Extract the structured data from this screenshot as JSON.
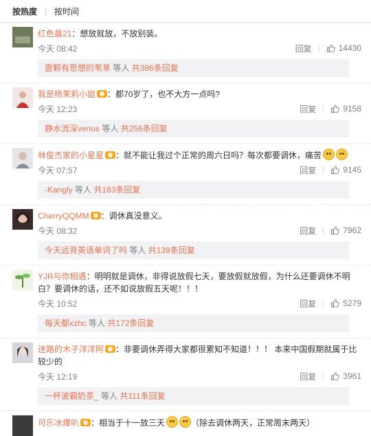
{
  "sort": {
    "hot": "按热度",
    "time": "按时间"
  },
  "comments": [
    {
      "user": "红色晨21",
      "vip": false,
      "text": "：想放就放，不放别装。",
      "emoji_count": 0,
      "time": "今天 08:42",
      "reply": "回复",
      "likes": "14430",
      "sub": {
        "name": "壹颗有思想的苇草",
        "mid": " 等人 ",
        "count": "共386条回复"
      },
      "avatar_color": "#6f7a5c"
    },
    {
      "user": "我是杨茉莉小姐",
      "vip": true,
      "text": "：都70岁了，也不大方一点吗?",
      "emoji_count": 0,
      "time": "今天 12:23",
      "reply": "回复",
      "likes": "9158",
      "sub": {
        "name": "静水流深venus",
        "mid": " 等人 ",
        "count": "共256条回复"
      },
      "avatar_color": "#c9302c"
    },
    {
      "user": "林俊杰家的小星星",
      "vip": true,
      "text": "：就不能让我过个正常的周六日吗？每次都要调休，痛苦",
      "emoji_count": 2,
      "time": "今天 07:57",
      "reply": "回复",
      "likes": "9145",
      "sub": {
        "name": "-Kangly",
        "mid": " 等人 ",
        "count": "共183条回复"
      },
      "avatar_color": "#8a8f96"
    },
    {
      "user": "CherryQQMM",
      "vip": true,
      "text": "：调休真没意义。",
      "emoji_count": 0,
      "time": "今天 08:32",
      "reply": "回复",
      "likes": "7962",
      "sub": {
        "name": "今天远背英语单词了吗",
        "mid": " 等人 ",
        "count": "共139条回复"
      },
      "avatar_color": "#b98a7a"
    },
    {
      "user": "YJR与你相遇",
      "vip": false,
      "text": "：明明就是调休，非得说放假七天，要放假就放假，为什么还要调休不明白？要调休的话，还不如说放假五天呢！！！",
      "emoji_count": 0,
      "time": "今天 10:52",
      "reply": "回复",
      "likes": "5279",
      "sub": {
        "name": "每天都xzhc",
        "mid": " 等人 ",
        "count": "共172条回复"
      },
      "avatar_color": "#6aa84f"
    },
    {
      "user": "迷路的木子洋洋阿",
      "vip": true,
      "text": "：非要调休弄得大家都很累知不知道！！！ 本来中国假期就属于比较少的",
      "emoji_count": 0,
      "time": "今天 12:19",
      "reply": "回复",
      "likes": "3961",
      "sub": {
        "name": "一杯波霸奶茶_",
        "mid": " 等人 ",
        "count": "共111条回复"
      },
      "avatar_color": "#a9a9b0"
    },
    {
      "user": "可乐冰爆叭",
      "vip": true,
      "text": "：相当于十一放三天",
      "emoji_count": 2,
      "text2": "（除去调休两天，正常周末两天）",
      "time": "",
      "reply": "",
      "likes": "",
      "sub": null,
      "avatar_color": "#3b3b3b"
    }
  ],
  "colors": {
    "username": "#eb7350",
    "meta": "#808080",
    "reply_bg": "#f2f2f5"
  }
}
